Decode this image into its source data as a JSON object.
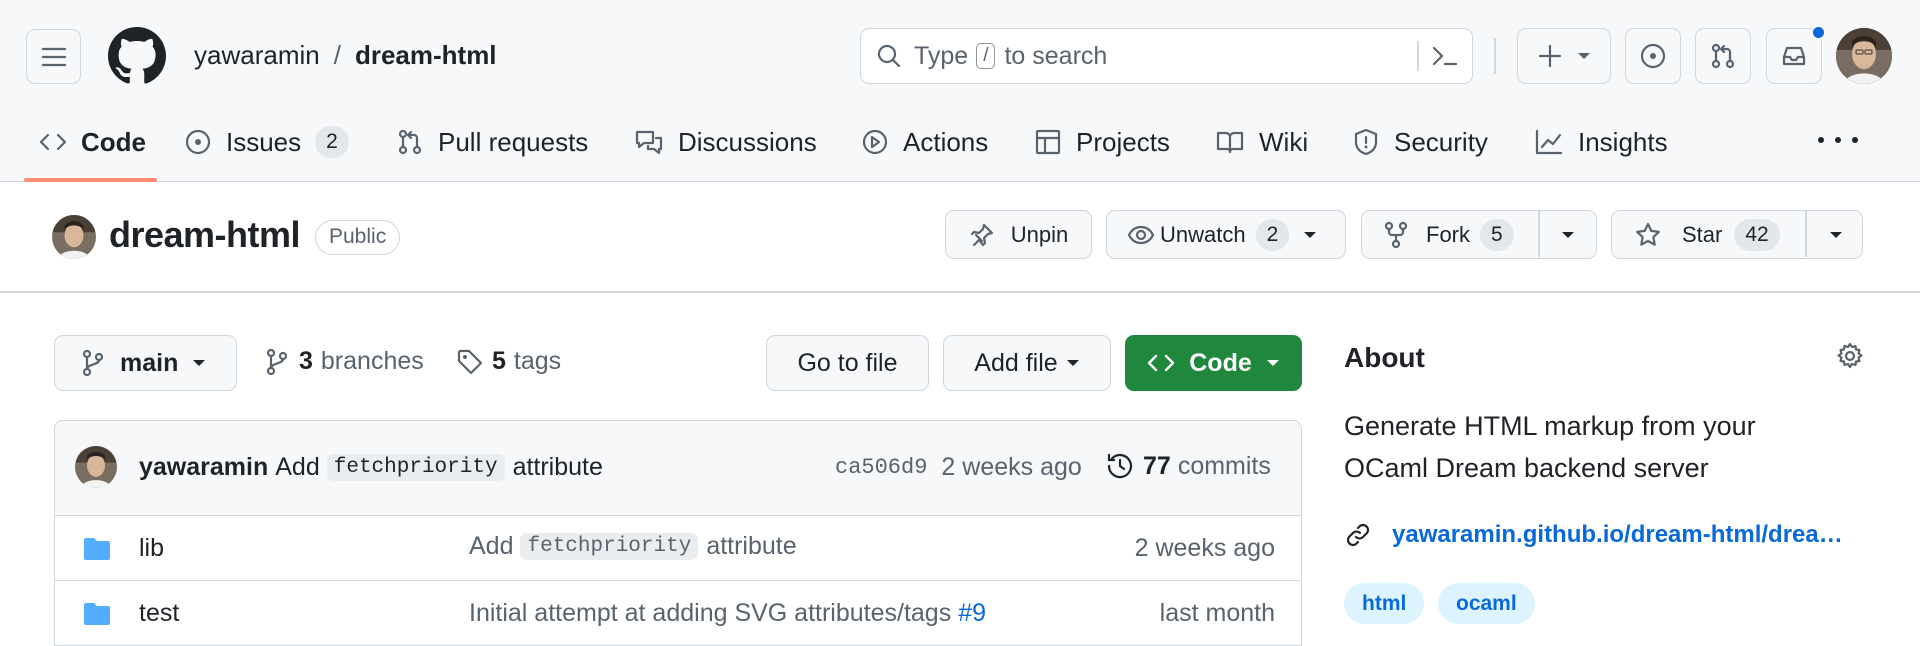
{
  "header": {
    "owner": "yawaramin",
    "separator": "/",
    "repo": "dream-html",
    "search_placeholder_prefix": "Type",
    "search_slash": "/",
    "search_placeholder_suffix": "to search"
  },
  "tabs": [
    {
      "label": "Code",
      "icon": "code-icon",
      "active": true
    },
    {
      "label": "Issues",
      "icon": "issue-icon",
      "count": "2"
    },
    {
      "label": "Pull requests",
      "icon": "pull-request-icon"
    },
    {
      "label": "Discussions",
      "icon": "discussions-icon"
    },
    {
      "label": "Actions",
      "icon": "play-icon"
    },
    {
      "label": "Projects",
      "icon": "table-icon"
    },
    {
      "label": "Wiki",
      "icon": "book-icon"
    },
    {
      "label": "Security",
      "icon": "shield-icon"
    },
    {
      "label": "Insights",
      "icon": "graph-icon"
    }
  ],
  "repo_head": {
    "name": "dream-html",
    "visibility": "Public",
    "unpin": "Unpin",
    "unwatch": "Unwatch",
    "watch_count": "2",
    "fork": "Fork",
    "fork_count": "5",
    "star": "Star",
    "star_count": "42"
  },
  "toolbar": {
    "branch": "main",
    "branches_count": "3",
    "branches_label": "branches",
    "tags_count": "5",
    "tags_label": "tags",
    "go_to_file": "Go to file",
    "add_file": "Add file",
    "code": "Code"
  },
  "commit": {
    "author": "yawaramin",
    "msg_prefix": "Add",
    "msg_code": "fetchpriority",
    "msg_suffix": "attribute",
    "sha": "ca506d9",
    "when": "2 weeks ago",
    "commits_count": "77",
    "commits_label": "commits"
  },
  "files": [
    {
      "name": "lib",
      "type": "folder",
      "msg_prefix": "Add",
      "msg_code": "fetchpriority",
      "msg_suffix": "attribute",
      "when": "2 weeks ago"
    },
    {
      "name": "test",
      "type": "folder",
      "msg_text": "Initial attempt at adding SVG attributes/tags",
      "msg_link": "#9",
      "when": "last month"
    }
  ],
  "about": {
    "title": "About",
    "description_line1": "Generate HTML markup from your",
    "description_line2": "OCaml Dream backend server",
    "link": "yawaramin.github.io/dream-html/drea…",
    "topics": [
      "html",
      "ocaml"
    ]
  },
  "colors": {
    "accent_green": "#1f883d",
    "link_blue": "#0969da",
    "tab_underline": "#fd8c73",
    "folder_blue": "#54aeff",
    "notification_dot": "#0969da"
  }
}
